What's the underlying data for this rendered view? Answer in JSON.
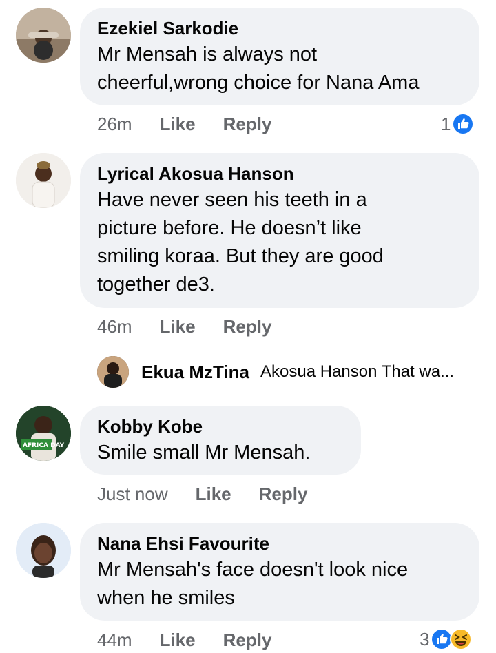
{
  "comments": [
    {
      "name": "Ezekiel Sarkodie",
      "lines": [
        "Mr Mensah is always not",
        "cheerful,wrong choice for Nana Ama"
      ],
      "time": "26m",
      "like": "Like",
      "reply": "Reply",
      "reaction_count": "1",
      "reaction_icons": [
        "like-icon"
      ]
    },
    {
      "name": "Lyrical Akosua Hanson",
      "lines": [
        "Have never seen his teeth in a",
        "picture before. He doesn’t like",
        "smiling koraa. But they are good",
        "together de3."
      ],
      "time": "46m",
      "like": "Like",
      "reply": "Reply"
    },
    {
      "name": "Kobby Kobe",
      "lines": [
        "Smile small Mr Mensah."
      ],
      "time": "Just now",
      "like": "Like",
      "reply": "Reply",
      "avatar_text": "AFRICA DAY"
    },
    {
      "name": "Nana Ehsi Favourite",
      "lines": [
        "Mr Mensah's face doesn't look nice",
        "when he smiles"
      ],
      "time": "44m",
      "like": "Like",
      "reply": "Reply",
      "reaction_count": "3",
      "reaction_icons": [
        "like-icon",
        "haha-icon"
      ]
    }
  ],
  "reply_preview": {
    "name": "Ekua MzTina",
    "text": "Akosua Hanson That wa..."
  },
  "colors": {
    "bubble": "#f0f2f5",
    "secondary_text": "#65676b",
    "like_blue": "#1877f2",
    "haha_yellow": "#f7b928"
  }
}
